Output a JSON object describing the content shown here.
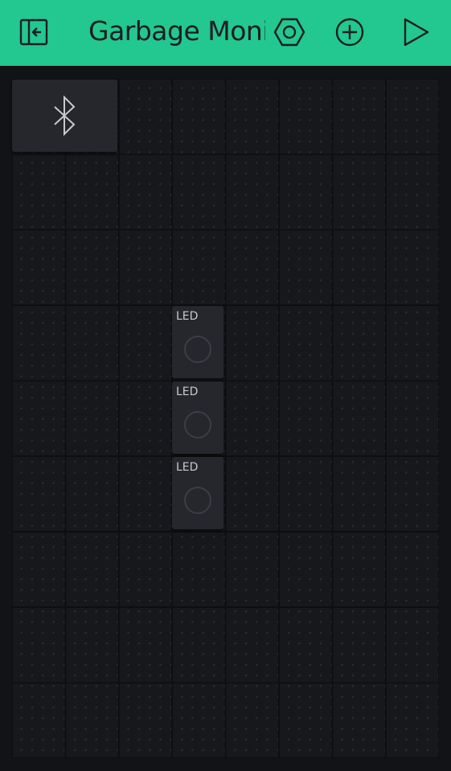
{
  "header": {
    "title": "Garbage Monit",
    "icons": {
      "back": "exit-icon",
      "settings": "hex-nut-icon",
      "add": "plus-circle-icon",
      "play": "play-icon"
    },
    "accent": "#22c88f"
  },
  "widgets": {
    "bluetooth": {
      "icon": "bluetooth-icon"
    },
    "leds": [
      {
        "label": "LED"
      },
      {
        "label": "LED"
      },
      {
        "label": "LED"
      }
    ]
  }
}
